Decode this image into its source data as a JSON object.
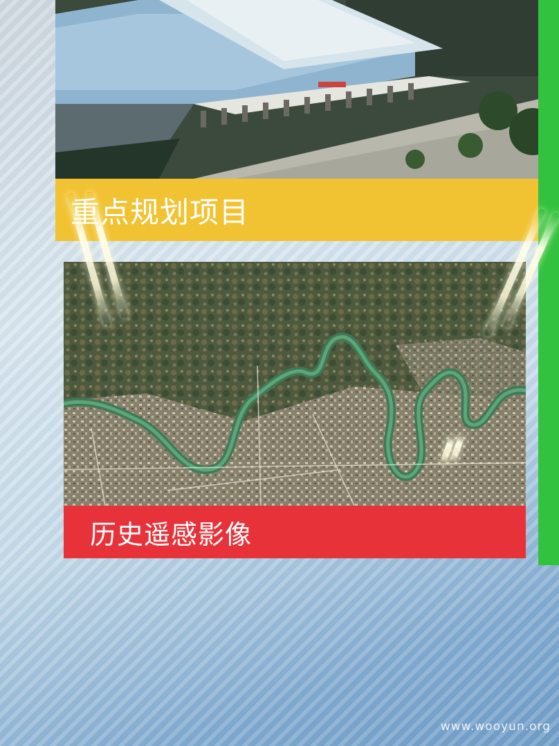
{
  "panels": [
    {
      "caption": "重点规划项目",
      "image": "railway-station-aerial-rendering",
      "caption_color": "#f1c232"
    },
    {
      "caption": "历史遥感影像",
      "image": "satellite-river-map",
      "caption_color": "#e8323a"
    }
  ],
  "side_tile_color": "#33c23f",
  "watermark": "www.wooyun.org"
}
